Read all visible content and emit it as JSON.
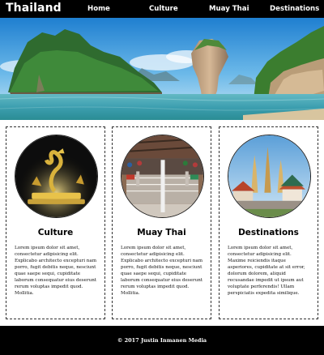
{
  "header": {
    "site_title": "Thailand",
    "nav": [
      {
        "label": "Home"
      },
      {
        "label": "Culture"
      },
      {
        "label": "Muay Thai"
      },
      {
        "label": "Destinations"
      }
    ]
  },
  "hero": {
    "image": "thailand-islands-seascape"
  },
  "cards": [
    {
      "title": "Culture",
      "image": "golden-naga-statue-night",
      "text": "Lorem ipsum dolor sit amet, consectetur adipisicing elit. Explicabo architecto excepturi nam porro, fugit debitis neque, nesciunt quae saepe sequi, cupiditate laborum consequatur eius deserunt rerum voluptas impedit quod. Mollitia."
    },
    {
      "title": "Muay Thai",
      "image": "muay-thai-boxing-ring",
      "text": "Lorem ipsum dolor sit amet, consectetur adipisicing elit. Explicabo architecto excepturi nam porro, fugit debitis neque, nesciunt quae saepe sequi, cupiditate laborum consequatur eius deserunt rerum voluptas impedit quod. Mollitia."
    },
    {
      "title": "Destinations",
      "image": "thai-temple-pagodas",
      "text": "Lorem ipsum dolor sit amet, consectetur adipisicing elit. Maxime reiciendis itaque asperiores, cupiditate at sit error, dolorum dolorem, aliquid recusandae impedit ut ipsum aut voluptate perferendis! Ullam perspiciatis expedita similique."
    }
  ],
  "footer": {
    "text": "© 2017 Justin Inmanen Media"
  },
  "colors": {
    "header_bg": "#000000",
    "header_text": "#ffffff",
    "footer_bg": "#000000",
    "sea": "#3fa7b8",
    "sky": "#2f8fd6"
  }
}
